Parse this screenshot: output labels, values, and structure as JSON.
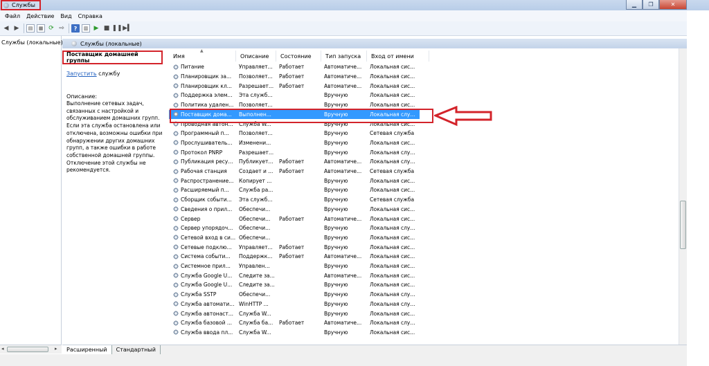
{
  "window": {
    "title": "Службы",
    "minimize_icon": "minimize-icon",
    "maximize_icon": "restore-icon",
    "close_icon": "close-icon"
  },
  "menu": [
    "Файл",
    "Действие",
    "Вид",
    "Справка"
  ],
  "toolbar": [
    "back-icon",
    "forward-icon",
    "console-tree-icon",
    "properties-icon",
    "refresh-icon",
    "export-icon",
    "help-icon",
    "view-icon",
    "start-icon",
    "stop-icon",
    "pause-icon",
    "restart-icon"
  ],
  "tree": {
    "root": "Службы (локальные)"
  },
  "pane_header": "Службы (локальные)",
  "detail": {
    "service_name": "Поставщик домашней группы",
    "start_link": "Запустить",
    "start_suffix": " службу",
    "description_label": "Описание:",
    "description": "Выполнение сетевых задач, связанных с настройкой и обслуживанием домашних групп. Если эта служба остановлена или отключена, возможны ошибки при обнаружении других домашних групп, а также ошибки в работе собственной домашней группы. Отключение этой службы не рекомендуется."
  },
  "columns": [
    "Имя",
    "Описание",
    "Состояние",
    "Тип запуска",
    "Вход от имени"
  ],
  "rows": [
    [
      "Питание",
      "Управляет...",
      "Работает",
      "Автоматиче...",
      "Локальная сис..."
    ],
    [
      "Планировщик за...",
      "Позволяет...",
      "Работает",
      "Автоматиче...",
      "Локальная сис..."
    ],
    [
      "Планировщик кл...",
      "Разрешает...",
      "Работает",
      "Автоматиче...",
      "Локальная сис..."
    ],
    [
      "Поддержка элем...",
      "Эта служб...",
      "",
      "Вручную",
      "Локальная сис..."
    ],
    [
      "Политика удален...",
      "Позволяет...",
      "",
      "Вручную",
      "Локальная сис..."
    ],
    [
      "Поставщик дома...",
      "Выполнен...",
      "",
      "Вручную",
      "Локальная слу..."
    ],
    [
      "Проводная автон...",
      "Служба W...",
      "",
      "Вручную",
      "Локальная сис..."
    ],
    [
      "Программный п...",
      "Позволяет...",
      "",
      "Вручную",
      "Сетевая служба"
    ],
    [
      "Прослушиватель...",
      "Изменени...",
      "",
      "Вручную",
      "Локальная сис..."
    ],
    [
      "Протокол PNRP",
      "Разрешает...",
      "",
      "Вручную",
      "Локальная слу..."
    ],
    [
      "Публикация ресу...",
      "Публикует...",
      "Работает",
      "Автоматиче...",
      "Локальная слу..."
    ],
    [
      "Рабочая станция",
      "Создает и ...",
      "Работает",
      "Автоматиче...",
      "Сетевая служба"
    ],
    [
      "Распространение...",
      "Копирует ...",
      "",
      "Вручную",
      "Локальная сис..."
    ],
    [
      "Расширяемый п...",
      "Служба ра...",
      "",
      "Вручную",
      "Локальная сис..."
    ],
    [
      "Сборщик событи...",
      "Эта служб...",
      "",
      "Вручную",
      "Сетевая служба"
    ],
    [
      "Сведения о прил...",
      "Обеспечи...",
      "",
      "Вручную",
      "Локальная сис..."
    ],
    [
      "Сервер",
      "Обеспечи...",
      "Работает",
      "Автоматиче...",
      "Локальная сис..."
    ],
    [
      "Сервер упорядоч...",
      "Обеспечи...",
      "",
      "Вручную",
      "Локальная слу..."
    ],
    [
      "Сетевой вход в си...",
      "Обеспечи...",
      "",
      "Вручную",
      "Локальная сис..."
    ],
    [
      "Сетевые подклю...",
      "Управляет...",
      "Работает",
      "Вручную",
      "Локальная сис..."
    ],
    [
      "Система событи...",
      "Поддержк...",
      "Работает",
      "Автоматиче...",
      "Локальная сис..."
    ],
    [
      "Системное прил...",
      "Управлен...",
      "",
      "Вручную",
      "Локальная сис..."
    ],
    [
      "Служба Google U...",
      "Следите за...",
      "",
      "Автоматиче...",
      "Локальная сис..."
    ],
    [
      "Служба Google U...",
      "Следите за...",
      "",
      "Вручную",
      "Локальная сис..."
    ],
    [
      "Служба SSTP",
      "Обеспечи...",
      "",
      "Вручную",
      "Локальная слу..."
    ],
    [
      "Служба автомати...",
      "WinHTTP ...",
      "",
      "Вручную",
      "Локальная слу..."
    ],
    [
      "Служба автонаст...",
      "Служба W...",
      "",
      "Вручную",
      "Локальная сис..."
    ],
    [
      "Служба базовой ...",
      "Служба ба...",
      "Работает",
      "Автоматиче...",
      "Локальная слу..."
    ],
    [
      "Служба ввода пл...",
      "Служба W...",
      "",
      "Вручную",
      "Локальная сис..."
    ]
  ],
  "selected_row": 5,
  "tabs": [
    "Расширенный",
    "Стандартный"
  ],
  "colors": {
    "selection": "#3399ff",
    "annotation": "#d3232a",
    "link": "#1f5fbf"
  }
}
